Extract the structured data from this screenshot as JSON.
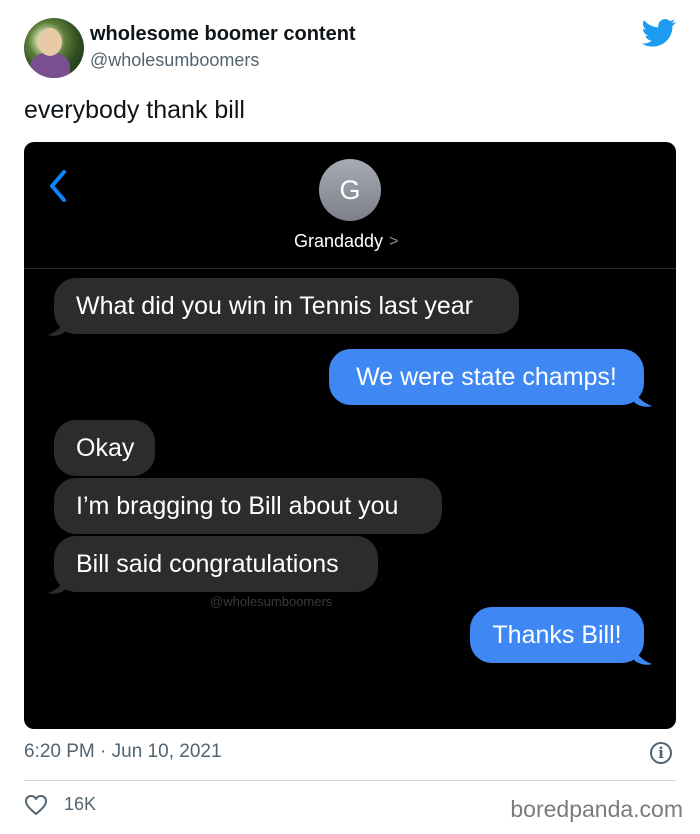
{
  "author": {
    "display_name": "wholesome boomer content",
    "handle": "@wholesumboomers",
    "avatar_icon": "profile-photo"
  },
  "tweet": {
    "text": "everybody thank bill",
    "timestamp": "6:20 PM · Jun 10, 2021",
    "likes": "16K"
  },
  "screenshot": {
    "contact_initial": "G",
    "contact_name": "Grandaddy",
    "contact_chevron": ">",
    "watermark": "@wholesumboomers",
    "messages": [
      {
        "direction": "in",
        "text": "What did you win in Tennis last year"
      },
      {
        "direction": "out",
        "text": "We were state champs!"
      },
      {
        "direction": "in",
        "text": "Okay"
      },
      {
        "direction": "in",
        "text": "I’m bragging to Bill about you"
      },
      {
        "direction": "in",
        "text": "Bill said congratulations"
      },
      {
        "direction": "out",
        "text": "Thanks Bill!"
      }
    ]
  },
  "footer": {
    "info_symbol": "i",
    "source": "boredpanda.com"
  },
  "colors": {
    "twitter_blue": "#1d9bf0",
    "imessage_blue": "#3f88f4",
    "incoming_bubble": "#2c2c2e",
    "muted_text": "#536471"
  }
}
